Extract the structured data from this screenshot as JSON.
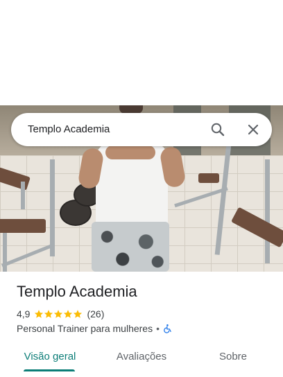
{
  "search": {
    "query": "Templo Academia",
    "search_icon": "search-icon",
    "close_icon": "close-icon"
  },
  "place": {
    "name": "Templo Academia",
    "rating": "4,9",
    "rating_value": 4.9,
    "stars_filled": 5,
    "reviews_count": "(26)",
    "category": "Personal Trainer para mulheres",
    "separator": "•",
    "accessibility_icon": "wheelchair-icon"
  },
  "tabs": [
    {
      "label": "Visão geral",
      "active": true
    },
    {
      "label": "Avaliações",
      "active": false
    },
    {
      "label": "Sobre",
      "active": false
    }
  ],
  "colors": {
    "accent": "#0b7d77",
    "star": "#fbbc04",
    "accessibility": "#1a73e8"
  }
}
